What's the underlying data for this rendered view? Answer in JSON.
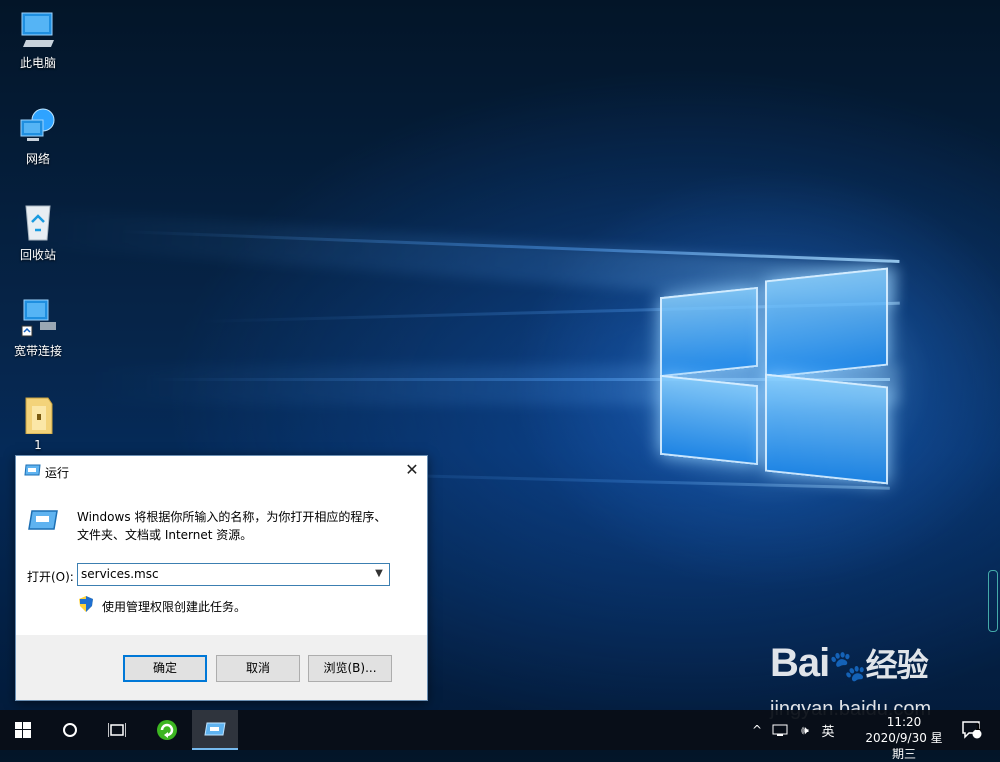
{
  "desktop": {
    "icons": [
      {
        "label": "此电脑",
        "icon": "this-pc-icon"
      },
      {
        "label": "网络",
        "icon": "network-icon"
      },
      {
        "label": "回收站",
        "icon": "recycle-bin-icon"
      },
      {
        "label": "宽带连接",
        "icon": "broadband-connection-icon"
      },
      {
        "label": "1",
        "icon": "folder-icon"
      }
    ]
  },
  "run_dialog": {
    "title": "运行",
    "description_line1": "Windows 将根据你所输入的名称，为你打开相应的程序、",
    "description_line2": "文件夹、文档或 Internet 资源。",
    "open_label": "打开(O):",
    "input_value": "services.msc",
    "admin_note": "使用管理权限创建此任务。",
    "buttons": {
      "ok": "确定",
      "cancel": "取消",
      "browse": "浏览(B)..."
    }
  },
  "taskbar": {
    "tray": {
      "chevron": "^",
      "volume": "🕪",
      "ime": "英"
    },
    "clock_time": "11:20",
    "clock_date": "2020/9/30 星期三",
    "notification_count": "1"
  },
  "watermark": {
    "brand": "Bai",
    "brand_cn": "经验",
    "url": "jingyan.baidu.com"
  },
  "colors": {
    "accent": "#0078d7",
    "taskbar": "#080e16"
  }
}
